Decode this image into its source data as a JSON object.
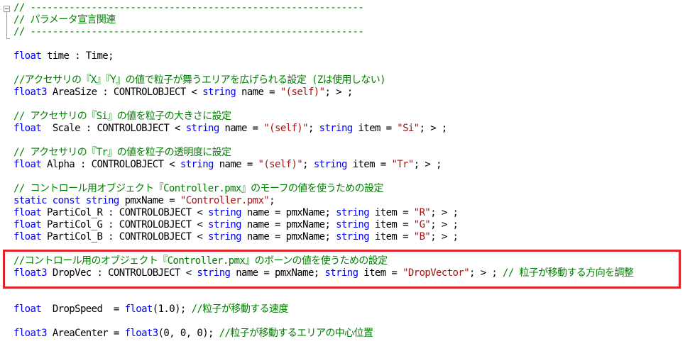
{
  "colors": {
    "keyword": "#0000ff",
    "comment": "#008000",
    "string": "#a31515",
    "text": "#000000",
    "highlight_border": "#e0222a"
  },
  "gutter": {
    "fold_icon": "fold-collapse-icon"
  },
  "code_lines": [
    [
      {
        "c": "cm",
        "t": "// ------------------------------------------------------------"
      }
    ],
    [
      {
        "c": "cm",
        "t": "// パラメータ宣言関連"
      }
    ],
    [
      {
        "c": "cm",
        "t": "// ------------------------------------------------------------"
      }
    ],
    [],
    [
      {
        "c": "kw",
        "t": "float"
      },
      {
        "c": "",
        "t": " time : Time;"
      }
    ],
    [],
    [
      {
        "c": "cm",
        "t": "//アクセサリの『X』『Y』の値で粒子が舞うエリアを広げられる設定 (Zは使用しない)"
      }
    ],
    [
      {
        "c": "kw",
        "t": "float3"
      },
      {
        "c": "",
        "t": " AreaSize : CONTROLOBJECT < "
      },
      {
        "c": "kw",
        "t": "string"
      },
      {
        "c": "",
        "t": " name = "
      },
      {
        "c": "st",
        "t": "\"(self)\""
      },
      {
        "c": "",
        "t": "; > ;"
      }
    ],
    [],
    [
      {
        "c": "cm",
        "t": "// アクセサリの『Si』の値を粒子の大きさに設定"
      }
    ],
    [
      {
        "c": "kw",
        "t": "float"
      },
      {
        "c": "",
        "t": "  Scale : CONTROLOBJECT < "
      },
      {
        "c": "kw",
        "t": "string"
      },
      {
        "c": "",
        "t": " name = "
      },
      {
        "c": "st",
        "t": "\"(self)\""
      },
      {
        "c": "",
        "t": "; "
      },
      {
        "c": "kw",
        "t": "string"
      },
      {
        "c": "",
        "t": " item = "
      },
      {
        "c": "st",
        "t": "\"Si\""
      },
      {
        "c": "",
        "t": "; > ;"
      }
    ],
    [],
    [
      {
        "c": "cm",
        "t": "// アクセサリの『Tr』の値を粒子の透明度に設定"
      }
    ],
    [
      {
        "c": "kw",
        "t": "float"
      },
      {
        "c": "",
        "t": " Alpha : CONTROLOBJECT < "
      },
      {
        "c": "kw",
        "t": "string"
      },
      {
        "c": "",
        "t": " name = "
      },
      {
        "c": "st",
        "t": "\"(self)\""
      },
      {
        "c": "",
        "t": "; "
      },
      {
        "c": "kw",
        "t": "string"
      },
      {
        "c": "",
        "t": " item = "
      },
      {
        "c": "st",
        "t": "\"Tr\""
      },
      {
        "c": "",
        "t": "; > ;"
      }
    ],
    [],
    [
      {
        "c": "cm",
        "t": "// コントロール用オブジェクト『Controller.pmx』のモーフの値を使うための設定"
      }
    ],
    [
      {
        "c": "kw",
        "t": "static const string"
      },
      {
        "c": "",
        "t": " pmxName = "
      },
      {
        "c": "st",
        "t": "\"Controller.pmx\""
      },
      {
        "c": "",
        "t": ";"
      }
    ],
    [
      {
        "c": "kw",
        "t": "float"
      },
      {
        "c": "",
        "t": " PartiCol_R : CONTROLOBJECT < "
      },
      {
        "c": "kw",
        "t": "string"
      },
      {
        "c": "",
        "t": " name = pmxName; "
      },
      {
        "c": "kw",
        "t": "string"
      },
      {
        "c": "",
        "t": " item = "
      },
      {
        "c": "st",
        "t": "\"R\""
      },
      {
        "c": "",
        "t": "; > ;"
      }
    ],
    [
      {
        "c": "kw",
        "t": "float"
      },
      {
        "c": "",
        "t": " PartiCol_G : CONTROLOBJECT < "
      },
      {
        "c": "kw",
        "t": "string"
      },
      {
        "c": "",
        "t": " name = pmxName; "
      },
      {
        "c": "kw",
        "t": "string"
      },
      {
        "c": "",
        "t": " item = "
      },
      {
        "c": "st",
        "t": "\"G\""
      },
      {
        "c": "",
        "t": "; > ;"
      }
    ],
    [
      {
        "c": "kw",
        "t": "float"
      },
      {
        "c": "",
        "t": " PartiCol_B : CONTROLOBJECT < "
      },
      {
        "c": "kw",
        "t": "string"
      },
      {
        "c": "",
        "t": " name = pmxName; "
      },
      {
        "c": "kw",
        "t": "string"
      },
      {
        "c": "",
        "t": " item = "
      },
      {
        "c": "st",
        "t": "\"B\""
      },
      {
        "c": "",
        "t": "; > ;"
      }
    ],
    [],
    [
      {
        "c": "cm",
        "t": "//コントロール用のオブジェクト『Controller.pmx』のボーンの値を使うための設定"
      }
    ],
    [
      {
        "c": "kw",
        "t": "float3"
      },
      {
        "c": "",
        "t": " DropVec : CONTROLOBJECT < "
      },
      {
        "c": "kw",
        "t": "string"
      },
      {
        "c": "",
        "t": " name = pmxName; "
      },
      {
        "c": "kw",
        "t": "string"
      },
      {
        "c": "",
        "t": " item = "
      },
      {
        "c": "st",
        "t": "\"DropVector\""
      },
      {
        "c": "",
        "t": "; > ; "
      },
      {
        "c": "cm",
        "t": "// 粒子が移動する方向を調整"
      }
    ],
    [],
    [],
    [
      {
        "c": "kw",
        "t": "float"
      },
      {
        "c": "",
        "t": "  DropSpeed  = "
      },
      {
        "c": "kw",
        "t": "float"
      },
      {
        "c": "",
        "t": "(1.0); "
      },
      {
        "c": "cm",
        "t": "//粒子が移動する速度"
      }
    ],
    [],
    [
      {
        "c": "kw",
        "t": "float3"
      },
      {
        "c": "",
        "t": " AreaCenter = "
      },
      {
        "c": "kw",
        "t": "float3"
      },
      {
        "c": "",
        "t": "(0, 0, 0); "
      },
      {
        "c": "cm",
        "t": "//粒子が移動するエリアの中心位置"
      }
    ]
  ]
}
